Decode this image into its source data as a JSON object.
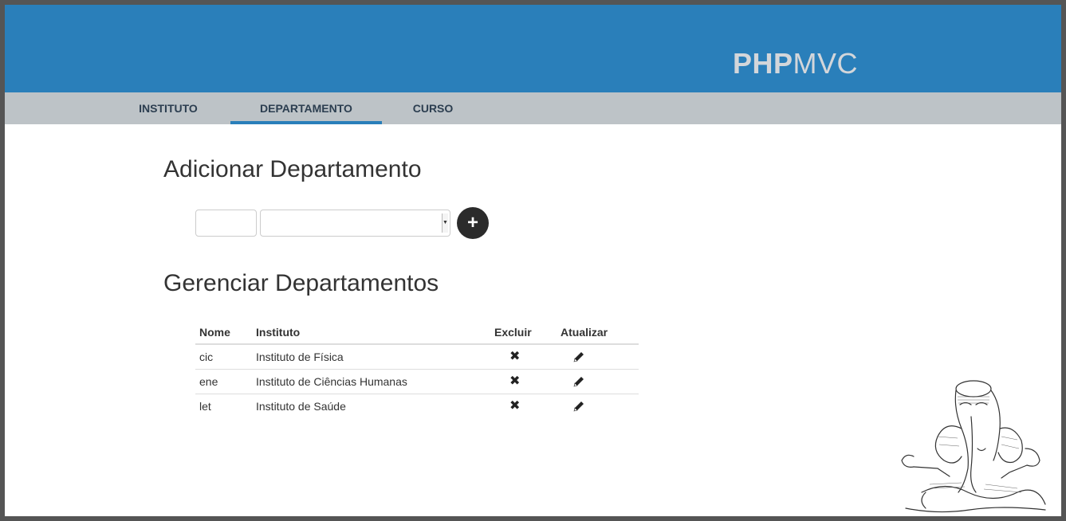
{
  "brand": {
    "bold": "PHP",
    "light": "MVC"
  },
  "nav": {
    "items": [
      "INSTITUTO",
      "DEPARTAMENTO",
      "CURSO"
    ],
    "active": "DEPARTAMENTO"
  },
  "add_section": {
    "title": "Adicionar Departamento",
    "name_value": "",
    "instituto_selected": "",
    "add_icon": "plus-icon"
  },
  "manage_section": {
    "title": "Gerenciar Departamentos",
    "columns": [
      "Nome",
      "Instituto",
      "Excluir",
      "Atualizar"
    ],
    "rows": [
      {
        "nome": "cic",
        "instituto": "Instituto de Física"
      },
      {
        "nome": "ene",
        "instituto": "Instituto de Ciências Humanas"
      },
      {
        "nome": "let",
        "instituto": "Instituto de Saúde"
      }
    ],
    "delete_icon": "x-icon",
    "edit_icon": "pencil-icon"
  },
  "colors": {
    "header": "#2a7fba",
    "nav": "#bdc3c7",
    "nav_text": "#2c3e50",
    "brand_text": "#d3d6da",
    "add_button": "#2b2b2b"
  }
}
